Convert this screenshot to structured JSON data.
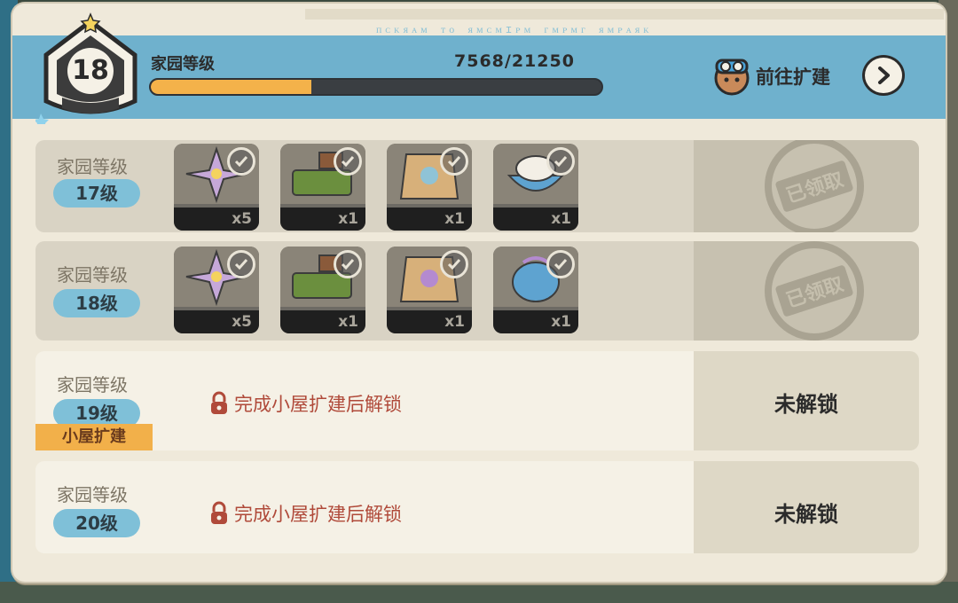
{
  "header": {
    "level": "18",
    "title": "家园等级",
    "exp_text": "7568/21250",
    "exp_fraction": 0.356,
    "goto_label": "前往扩建",
    "runes": "ᴨᴄᴋᴙᴀᴍ ᴛᴏ ᴙᴍᴄᴍɪᴘᴍ ᴦᴍᴘᴍᴦ ᴙᴍᴘᴀᴙᴋ"
  },
  "rows": [
    {
      "title": "家园等级",
      "level": "17级",
      "status": "claimed",
      "items": [
        {
          "icon": "rainbow-flower-icon",
          "count": "x5"
        },
        {
          "icon": "garden-plot-icon",
          "count": "x1"
        },
        {
          "icon": "seed-bag-icon",
          "count": "x1"
        },
        {
          "icon": "cream-bowl-icon",
          "count": "x1"
        }
      ],
      "stamp": "已领取"
    },
    {
      "title": "家园等级",
      "level": "18级",
      "status": "claimed",
      "items": [
        {
          "icon": "rainbow-flower-icon",
          "count": "x5"
        },
        {
          "icon": "garden-plot-icon",
          "count": "x1"
        },
        {
          "icon": "seed-bag-icon",
          "count": "x1"
        },
        {
          "icon": "gift-egg-icon",
          "count": "x1"
        }
      ],
      "stamp": "已领取"
    },
    {
      "title": "家园等级",
      "level": "19级",
      "status": "locked",
      "tag": "小屋扩建",
      "lock_message": "完成小屋扩建后解锁",
      "button": "未解锁"
    },
    {
      "title": "家园等级",
      "level": "20级",
      "status": "locked",
      "lock_message": "完成小屋扩建后解锁",
      "button": "未解锁"
    }
  ],
  "colors": {
    "exp_fill": "#f4b24a",
    "header_bg": "#6fb1cd",
    "lock_text": "#b04a3a"
  }
}
